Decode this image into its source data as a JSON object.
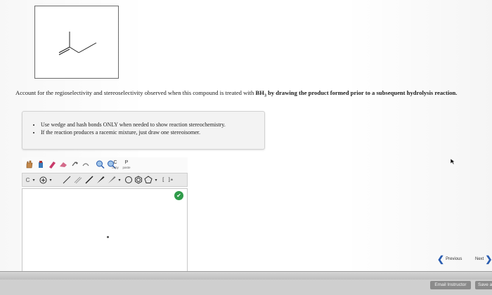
{
  "question": {
    "prefix": "Account for the regioselectivity and stereoselectivity observed when this compound is treated with ",
    "reagent": "BH",
    "reagent_sub": "3",
    "suffix": " by drawing the product formed prior to a subsequent hydrolysis reaction."
  },
  "hints": [
    "Use wedge and hash bonds ONLY when needed to show reaction stereochemistry.",
    "If the reaction produces a racemic mixture, just draw one stereoisomer."
  ],
  "toolbar": {
    "copy_label": "C",
    "copy_sub": "copy",
    "paste_label": "P",
    "paste_sub": "paste",
    "element_label": "C",
    "charge_label": "[ ]",
    "charge_sup": "±"
  },
  "nav": {
    "previous_label": "Previous",
    "next_label": "Next"
  },
  "footer": {
    "email_label": "Email Instructor",
    "save_label": "Save a"
  },
  "colors": {
    "accent": "#2a5db0",
    "green": "#2f9b4a"
  }
}
